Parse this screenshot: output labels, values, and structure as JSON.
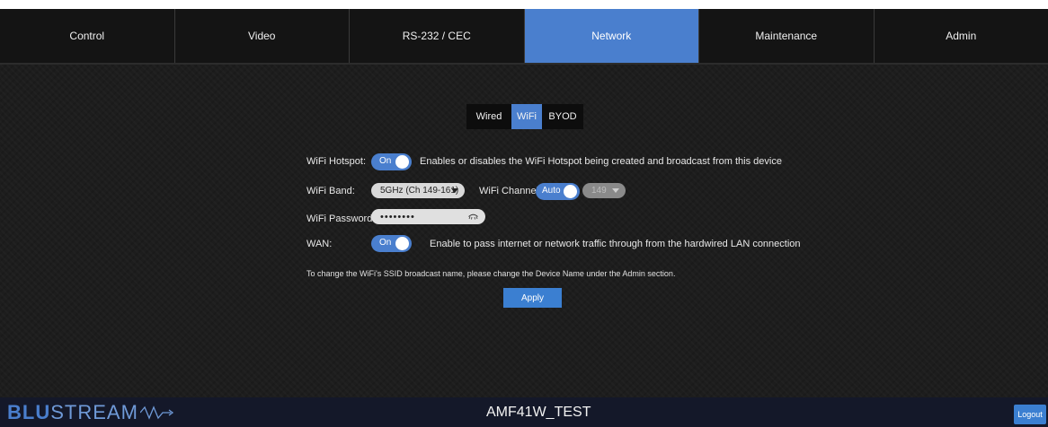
{
  "nav": {
    "tabs": [
      {
        "label": "Control"
      },
      {
        "label": "Video"
      },
      {
        "label": "RS-232 / CEC"
      },
      {
        "label": "Network"
      },
      {
        "label": "Maintenance"
      },
      {
        "label": "Admin"
      }
    ],
    "active_index": 3
  },
  "subtabs": {
    "items": [
      {
        "label": "Wired"
      },
      {
        "label": "WiFi"
      },
      {
        "label": "BYOD"
      }
    ],
    "active_index": 1
  },
  "form": {
    "hotspot": {
      "label": "WiFi Hotspot:",
      "toggle_text": "On",
      "description": "Enables or disables the WiFi Hotspot being created and broadcast from this device"
    },
    "band": {
      "label": "WiFi Band:",
      "selected": "5GHz (Ch 149-161)",
      "channel_label": "WiFi Channel:",
      "channel_toggle_text": "Auto",
      "channel_selected": "149"
    },
    "password": {
      "label": "WiFi Password:",
      "value": "••••••••",
      "eye_icon": "eye-icon"
    },
    "wan": {
      "label": "WAN:",
      "toggle_text": "On",
      "description": "Enable to pass internet or network traffic through from the hardwired LAN connection"
    },
    "note": "To change the WiFi's SSID broadcast name, please change the Device Name under the Admin section.",
    "apply_label": "Apply"
  },
  "footer": {
    "logo_bold": "BLU",
    "logo_light": "STREAM",
    "device_name": "AMF41W_TEST",
    "logout_label": "Logout"
  },
  "colors": {
    "accent": "#4a7fce",
    "button": "#3b7fd1",
    "background": "#1d1d1d",
    "footer": "#141829"
  }
}
